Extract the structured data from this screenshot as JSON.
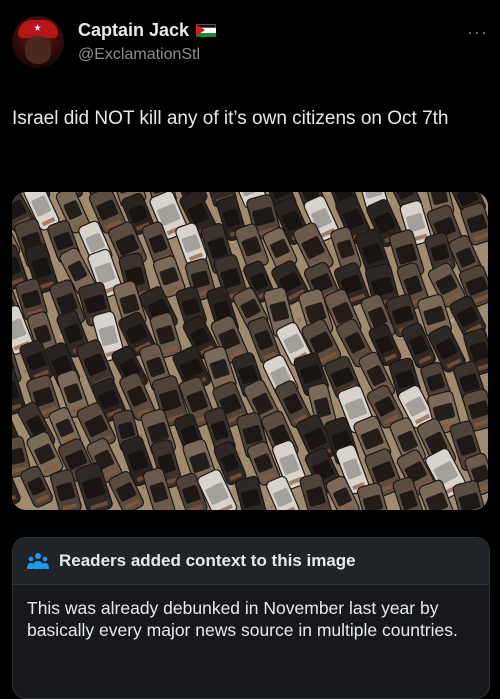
{
  "tweet": {
    "display_name": "Captain Jack",
    "handle": "@ExclamationStl",
    "badge_icon": "palestine-flag-icon",
    "avatar_icon": "avatar-red-cap",
    "more_icon": "more-options-icon",
    "text": "Israel did NOT kill any of it’s own citizens on Oct 7th"
  },
  "media": {
    "icon": "aerial-photo-burned-cars"
  },
  "community_note": {
    "title": "Readers added context to this image",
    "icon": "readers-people-icon",
    "accent": "#1d9bf0",
    "text": "This was already debunked in November last year by basically every major news source in multiple countries."
  },
  "colors": {
    "background": "#000000",
    "text_primary": "#e7e9ea",
    "text_secondary": "#71767b",
    "note_header": "#202327"
  }
}
